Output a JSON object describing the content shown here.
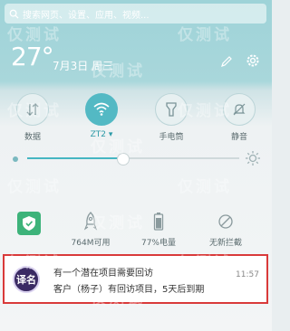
{
  "search": {
    "placeholder": "搜索网页、设置、应用、视频..."
  },
  "header": {
    "time": "27°",
    "date": "7月3日 周三"
  },
  "toggles": [
    {
      "label": "数据",
      "state": "off",
      "icon": "mobile-data-icon"
    },
    {
      "label": "ZT2",
      "chevron": "▾",
      "state": "on",
      "icon": "wifi-icon"
    },
    {
      "label": "手电筒",
      "state": "off",
      "icon": "flashlight-icon"
    },
    {
      "label": "静音",
      "state": "off",
      "icon": "bell-mute-icon"
    }
  ],
  "brightness": {
    "level": 0.45
  },
  "shortcuts": [
    {
      "label": "764M可用",
      "icon": "rocket-icon"
    },
    {
      "label": "77%电量",
      "icon": "battery-icon"
    },
    {
      "label": "无新拦截",
      "icon": "block-icon"
    }
  ],
  "notification": {
    "app_badge": "译名",
    "title": "有一个潜在项目需要回访",
    "body": "客户（杨子）有回访项目，5天后到期",
    "time": "11:57"
  },
  "watermark": "仅测试",
  "colors": {
    "accent": "#53b9c4",
    "security_green": "#3db37a",
    "highlight_border": "#d93a3a",
    "header_bg": "#9ed3d8"
  }
}
